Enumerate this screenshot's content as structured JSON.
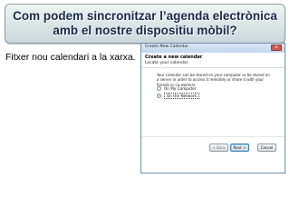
{
  "slide": {
    "title_line1": "Com podem sincronitzar l’agenda electrònica",
    "title_line2": "amb el nostre dispositiu mòbil?",
    "caption": "Fitxer nou calendari a la xarxa."
  },
  "dialog": {
    "window_title": "Create New Calendar",
    "close_label": "x",
    "heading": "Create a new calendar",
    "subheading": "Locate your calendar",
    "description": "Your calendar can be stored on your computer or be stored on a server in order to access it remotely or share it with your friends or co-workers.",
    "options": [
      {
        "label": "On My Computer",
        "selected": false
      },
      {
        "label": "On the Network",
        "selected": true
      }
    ],
    "buttons": {
      "back": "< Back",
      "next": "Next >",
      "cancel": "Cancel"
    }
  },
  "colors": {
    "title_text": "#1a2b4a",
    "title_gradient_top": "#eef5f2",
    "title_gradient_bottom": "#c9d7dc",
    "dialog_border": "#6c8eaa"
  }
}
